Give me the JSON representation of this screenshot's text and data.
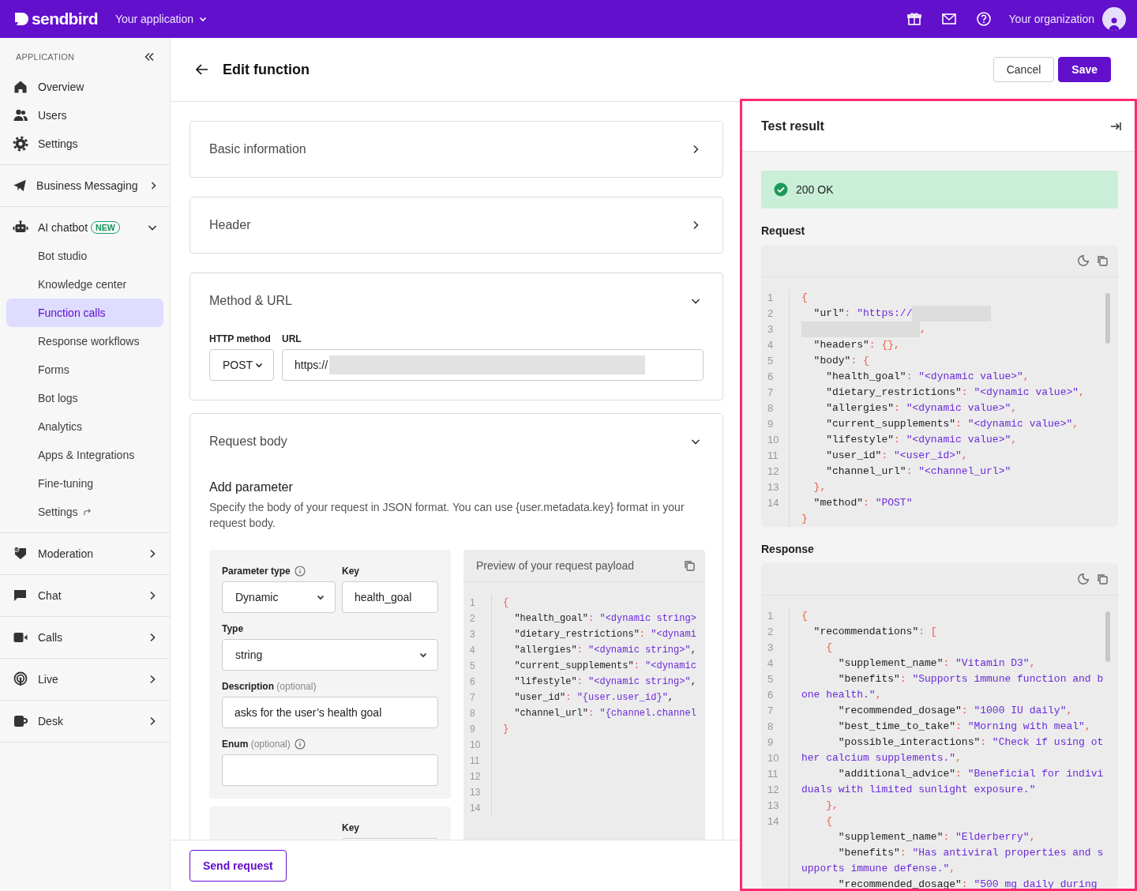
{
  "top_bar": {
    "brand": "sendbird",
    "app_switcher": "Your application",
    "organization": "Your organization"
  },
  "sidebar": {
    "heading": "APPLICATION",
    "groups": [
      {
        "items": [
          {
            "label": "Overview",
            "selected": false
          },
          {
            "label": "Users",
            "selected": false
          },
          {
            "label": "Settings",
            "selected": false
          }
        ]
      },
      {
        "items": [
          {
            "label": "Business Messaging",
            "selected": false,
            "expanded": false
          }
        ]
      },
      {
        "items": [
          {
            "label": "AI chatbot",
            "badge": "NEW",
            "selected": false,
            "expanded": true,
            "children": [
              {
                "label": "Bot studio",
                "selected": false,
                "external": false
              },
              {
                "label": "Knowledge center",
                "selected": false,
                "external": false
              },
              {
                "label": "Function calls",
                "selected": true,
                "external": false
              },
              {
                "label": "Response workflows",
                "selected": false,
                "external": false
              },
              {
                "label": "Forms",
                "selected": false,
                "external": false
              },
              {
                "label": "Bot logs",
                "selected": false,
                "external": false
              },
              {
                "label": "Analytics",
                "selected": false,
                "external": false
              },
              {
                "label": "Apps & Integrations",
                "selected": false,
                "external": false
              },
              {
                "label": "Fine-tuning",
                "selected": false,
                "external": false
              },
              {
                "label": "Settings",
                "selected": false,
                "external": true
              }
            ]
          }
        ]
      },
      {
        "items": [
          {
            "label": "Moderation",
            "selected": false,
            "expanded": false
          }
        ]
      },
      {
        "items": [
          {
            "label": "Chat",
            "selected": false,
            "expanded": false
          }
        ]
      },
      {
        "items": [
          {
            "label": "Calls",
            "selected": false,
            "expanded": false
          }
        ]
      },
      {
        "items": [
          {
            "label": "Live",
            "selected": false,
            "expanded": false
          }
        ]
      },
      {
        "items": [
          {
            "label": "Desk",
            "selected": false,
            "expanded": false
          }
        ]
      }
    ]
  },
  "page_header": {
    "title": "Edit function",
    "cancel": "Cancel",
    "save": "Save"
  },
  "sections": [
    {
      "title": "Basic information",
      "expanded": false,
      "kind": "basic_information"
    },
    {
      "title": "Header",
      "expanded": false,
      "kind": "header"
    },
    {
      "title": "Method & URL",
      "expanded": true,
      "kind": "method_url",
      "method_label": "HTTP method",
      "method": "POST",
      "url_label": "URL",
      "url": "https://",
      "url_redacted": true
    },
    {
      "title": "Request body",
      "expanded": true,
      "kind": "request_body",
      "heading": "Add parameter",
      "description": "Specify the body of your request in JSON format. You can use {user.metadata.key} format in your request body.",
      "parameters": [
        {
          "type_label": "Parameter type",
          "type": "Dynamic",
          "key_label": "Key",
          "key": "health_goal",
          "value_type_label": "Type",
          "value_type": "string",
          "description_label": "Description",
          "description_hint": "(optional)",
          "description": "asks for the user’s health goal",
          "enum_label": "Enum",
          "enum_hint": "(optional)"
        },
        {
          "key_label": "Key"
        }
      ],
      "preview": {
        "title": "Preview of your request payload",
        "lines": [
          {
            "number": "1",
            "tokens": [
              {
                "kind": "punct",
                "text": "{"
              }
            ]
          },
          {
            "number": "2",
            "tokens": [
              {
                "kind": "key",
                "text": "  \"health_goal\""
              },
              {
                "kind": "punct",
                "text": ": "
              },
              {
                "kind": "str",
                "text": "\"<dynamic string>"
              }
            ]
          },
          {
            "number": "3",
            "tokens": [
              {
                "kind": "key",
                "text": "  \"dietary_restrictions\""
              },
              {
                "kind": "punct",
                "text": ": "
              },
              {
                "kind": "str",
                "text": "\"<dynami"
              }
            ]
          },
          {
            "number": "4",
            "tokens": [
              {
                "kind": "key",
                "text": "  \"allergies\""
              },
              {
                "kind": "punct",
                "text": ": "
              },
              {
                "kind": "str",
                "text": "\"<dynamic string>\""
              },
              {
                "kind": "plain",
                "text": ","
              }
            ]
          },
          {
            "number": "5",
            "tokens": [
              {
                "kind": "key",
                "text": "  \"current_supplements\""
              },
              {
                "kind": "punct",
                "text": ": "
              },
              {
                "kind": "str",
                "text": "\"<dynamic"
              }
            ]
          },
          {
            "number": "6",
            "tokens": [
              {
                "kind": "key",
                "text": "  \"lifestyle\""
              },
              {
                "kind": "punct",
                "text": ": "
              },
              {
                "kind": "str",
                "text": "\"<dynamic string>\""
              },
              {
                "kind": "plain",
                "text": ","
              }
            ]
          },
          {
            "number": "7",
            "tokens": [
              {
                "kind": "key",
                "text": "  \"user_id\""
              },
              {
                "kind": "punct",
                "text": ": "
              },
              {
                "kind": "str",
                "text": "\"{user.user_id}\""
              },
              {
                "kind": "plain",
                "text": ","
              }
            ]
          },
          {
            "number": "8",
            "tokens": [
              {
                "kind": "key",
                "text": "  \"channel_url\""
              },
              {
                "kind": "punct",
                "text": ": "
              },
              {
                "kind": "str",
                "text": "\"{channel.channel"
              }
            ]
          },
          {
            "number": "9",
            "tokens": [
              {
                "kind": "punct",
                "text": "}"
              }
            ]
          },
          {
            "number": "10"
          },
          {
            "number": "11"
          },
          {
            "number": "12"
          },
          {
            "number": "13"
          },
          {
            "number": "14"
          }
        ]
      }
    }
  ],
  "footer": {
    "send_request": "Send request"
  },
  "test_result": {
    "title": "Test result",
    "status": {
      "text": "200 OK",
      "ok": true
    },
    "request": {
      "label": "Request",
      "lines": [
        {
          "number": "1",
          "tokens": [
            {
              "kind": "punct",
              "text": "{"
            }
          ]
        },
        {
          "number": "2",
          "tokens": [
            {
              "kind": "key",
              "text": "  \"url\""
            },
            {
              "kind": "punct",
              "text": ": "
            },
            {
              "kind": "str",
              "text": "\"https://"
            },
            {
              "kind": "redacted"
            }
          ]
        },
        {
          "number": "3",
          "tokens": [
            {
              "kind": "redacted"
            },
            {
              "kind": "punct",
              "text": ","
            }
          ]
        },
        {
          "number": "4",
          "tokens": [
            {
              "kind": "key",
              "text": "  \"headers\""
            },
            {
              "kind": "punct",
              "text": ": {},"
            }
          ]
        },
        {
          "number": "5",
          "tokens": [
            {
              "kind": "key",
              "text": "  \"body\""
            },
            {
              "kind": "punct",
              "text": ": {"
            }
          ]
        },
        {
          "number": "6",
          "tokens": [
            {
              "kind": "key",
              "text": "    \"health_goal\""
            },
            {
              "kind": "punct",
              "text": ": "
            },
            {
              "kind": "str",
              "text": "\"<dynamic value>\""
            },
            {
              "kind": "punct",
              "text": ","
            }
          ]
        },
        {
          "number": "7",
          "tokens": [
            {
              "kind": "key",
              "text": "    \"dietary_restrictions\""
            },
            {
              "kind": "punct",
              "text": ": "
            },
            {
              "kind": "str",
              "text": "\"<dynamic value>\""
            },
            {
              "kind": "punct",
              "text": ","
            }
          ]
        },
        {
          "number": "8",
          "tokens": [
            {
              "kind": "key",
              "text": "    \"allergies\""
            },
            {
              "kind": "punct",
              "text": ": "
            },
            {
              "kind": "str",
              "text": "\"<dynamic value>\""
            },
            {
              "kind": "punct",
              "text": ","
            }
          ]
        },
        {
          "number": "9",
          "tokens": [
            {
              "kind": "key",
              "text": "    \"current_supplements\""
            },
            {
              "kind": "punct",
              "text": ": "
            },
            {
              "kind": "str",
              "text": "\"<dynamic value>\""
            },
            {
              "kind": "punct",
              "text": ","
            }
          ]
        },
        {
          "number": "10",
          "tokens": [
            {
              "kind": "key",
              "text": "    \"lifestyle\""
            },
            {
              "kind": "punct",
              "text": ": "
            },
            {
              "kind": "str",
              "text": "\"<dynamic value>\""
            },
            {
              "kind": "punct",
              "text": ","
            }
          ]
        },
        {
          "number": "11",
          "tokens": [
            {
              "kind": "key",
              "text": "    \"user_id\""
            },
            {
              "kind": "punct",
              "text": ": "
            },
            {
              "kind": "str",
              "text": "\"<user_id>\""
            },
            {
              "kind": "punct",
              "text": ","
            }
          ]
        },
        {
          "number": "12",
          "tokens": [
            {
              "kind": "key",
              "text": "    \"channel_url\""
            },
            {
              "kind": "punct",
              "text": ": "
            },
            {
              "kind": "str",
              "text": "\"<channel_url>\""
            }
          ]
        },
        {
          "number": "13",
          "tokens": [
            {
              "kind": "punct",
              "text": "  },"
            }
          ]
        },
        {
          "number": "14",
          "tokens": [
            {
              "kind": "key",
              "text": "  \"method\""
            },
            {
              "kind": "punct",
              "text": ": "
            },
            {
              "kind": "str",
              "text": "\"POST\""
            }
          ]
        },
        {
          "tokens": [
            {
              "kind": "punct",
              "text": "}"
            }
          ]
        }
      ]
    },
    "response": {
      "label": "Response",
      "lines": [
        {
          "number": "1",
          "tokens": [
            {
              "kind": "punct",
              "text": "{"
            }
          ]
        },
        {
          "number": "2",
          "tokens": [
            {
              "kind": "key",
              "text": "  \"recommendations\""
            },
            {
              "kind": "punct",
              "text": ": ["
            }
          ]
        },
        {
          "number": "3",
          "tokens": [
            {
              "kind": "punct",
              "text": "    {"
            }
          ]
        },
        {
          "number": "4",
          "tokens": [
            {
              "kind": "key",
              "text": "      \"supplement_name\""
            },
            {
              "kind": "punct",
              "text": ": "
            },
            {
              "kind": "str",
              "text": "\"Vitamin D3\""
            },
            {
              "kind": "punct",
              "text": ","
            }
          ]
        },
        {
          "number": "5",
          "tokens": [
            {
              "kind": "key",
              "text": "      \"benefits\""
            },
            {
              "kind": "punct",
              "text": ": "
            },
            {
              "kind": "str",
              "text": "\"Supports immune function and b"
            }
          ]
        },
        {
          "number": "6",
          "tokens": [
            {
              "kind": "str",
              "text": "one health.\""
            },
            {
              "kind": "punct",
              "text": ","
            }
          ]
        },
        {
          "number": "7",
          "tokens": [
            {
              "kind": "key",
              "text": "      \"recommended_dosage\""
            },
            {
              "kind": "punct",
              "text": ": "
            },
            {
              "kind": "str",
              "text": "\"1000 IU daily\""
            },
            {
              "kind": "punct",
              "text": ","
            }
          ]
        },
        {
          "number": "8",
          "tokens": [
            {
              "kind": "key",
              "text": "      \"best_time_to_take\""
            },
            {
              "kind": "punct",
              "text": ": "
            },
            {
              "kind": "str",
              "text": "\"Morning with meal\""
            },
            {
              "kind": "punct",
              "text": ","
            }
          ]
        },
        {
          "number": "9",
          "tokens": [
            {
              "kind": "key",
              "text": "      \"possible_interactions\""
            },
            {
              "kind": "punct",
              "text": ": "
            },
            {
              "kind": "str",
              "text": "\"Check if using ot"
            }
          ]
        },
        {
          "number": "10",
          "tokens": [
            {
              "kind": "str",
              "text": "her calcium supplements.\""
            },
            {
              "kind": "punct",
              "text": ","
            }
          ]
        },
        {
          "number": "11",
          "tokens": [
            {
              "kind": "key",
              "text": "      \"additional_advice\""
            },
            {
              "kind": "punct",
              "text": ": "
            },
            {
              "kind": "str",
              "text": "\"Beneficial for indivi"
            }
          ]
        },
        {
          "number": "12",
          "tokens": [
            {
              "kind": "str",
              "text": "duals with limited sunlight exposure.\""
            }
          ]
        },
        {
          "number": "13",
          "tokens": [
            {
              "kind": "punct",
              "text": "    },"
            }
          ]
        },
        {
          "number": "14",
          "tokens": [
            {
              "kind": "punct",
              "text": "    {"
            }
          ]
        },
        {
          "tokens": [
            {
              "kind": "key",
              "text": "      \"supplement_name\""
            },
            {
              "kind": "punct",
              "text": ": "
            },
            {
              "kind": "str",
              "text": "\"Elderberry\""
            },
            {
              "kind": "punct",
              "text": ","
            }
          ]
        },
        {
          "tokens": [
            {
              "kind": "key",
              "text": "      \"benefits\""
            },
            {
              "kind": "punct",
              "text": ": "
            },
            {
              "kind": "str",
              "text": "\"Has antiviral properties and s"
            }
          ]
        },
        {
          "tokens": [
            {
              "kind": "str",
              "text": "upports immune defense.\""
            },
            {
              "kind": "punct",
              "text": ","
            }
          ]
        },
        {
          "tokens": [
            {
              "kind": "key",
              "text": "      \"recommended_dosage\""
            },
            {
              "kind": "punct",
              "text": ": "
            },
            {
              "kind": "str",
              "text": "\"500 mg daily during"
            }
          ]
        }
      ]
    }
  }
}
